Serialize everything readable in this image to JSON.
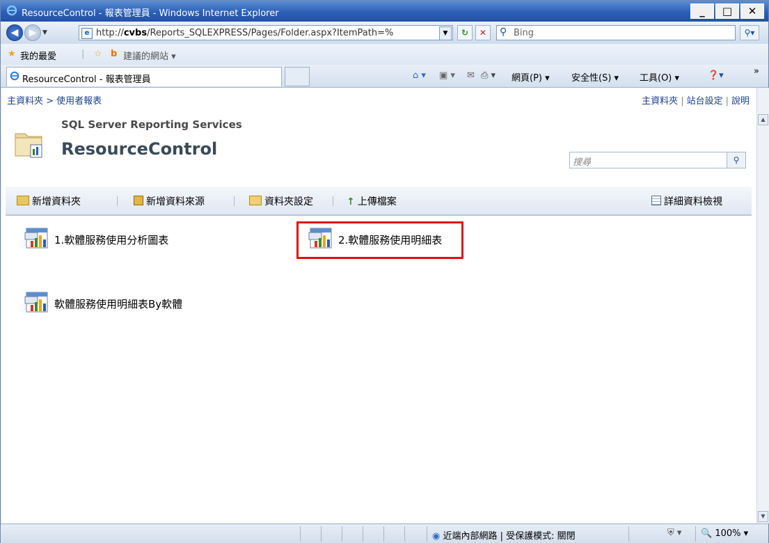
{
  "window": {
    "title": "ResourceControl - 報表管理員 - Windows Internet Explorer"
  },
  "address": {
    "url_prefix": "http://",
    "url_host": "cvbs",
    "url_rest": "/Reports_SQLEXPRESS/Pages/Folder.aspx?ItemPath=%"
  },
  "search": {
    "placeholder": "Bing"
  },
  "favorites": {
    "label": "我的最愛",
    "suggested": "建議的網站"
  },
  "tab": {
    "label": "ResourceControl - 報表管理員"
  },
  "commandbar": {
    "page": "網頁(P)",
    "safety": "安全性(S)",
    "tools": "工具(O)"
  },
  "breadcrumb": "主資料夾 > 使用者報表",
  "toplinks": {
    "home": "主資料夾",
    "site": "站台設定",
    "help": "說明"
  },
  "header": {
    "subtitle": "SQL Server Reporting Services",
    "title": "ResourceControl",
    "search_placeholder": "搜尋"
  },
  "toolbar": {
    "new_folder": "新增資料夾",
    "new_datasource": "新增資料來源",
    "folder_settings": "資料夾設定",
    "upload": "上傳檔案",
    "details_view": "詳細資料檢視"
  },
  "reports": [
    {
      "label": "1.軟體服務使用分析圖表"
    },
    {
      "label": "2.軟體服務使用明細表"
    },
    {
      "label": "軟體服務使用明細表By軟體"
    }
  ],
  "status": {
    "zone": "近端內部網路 | 受保護模式: 關閉",
    "zoom": "100%"
  }
}
